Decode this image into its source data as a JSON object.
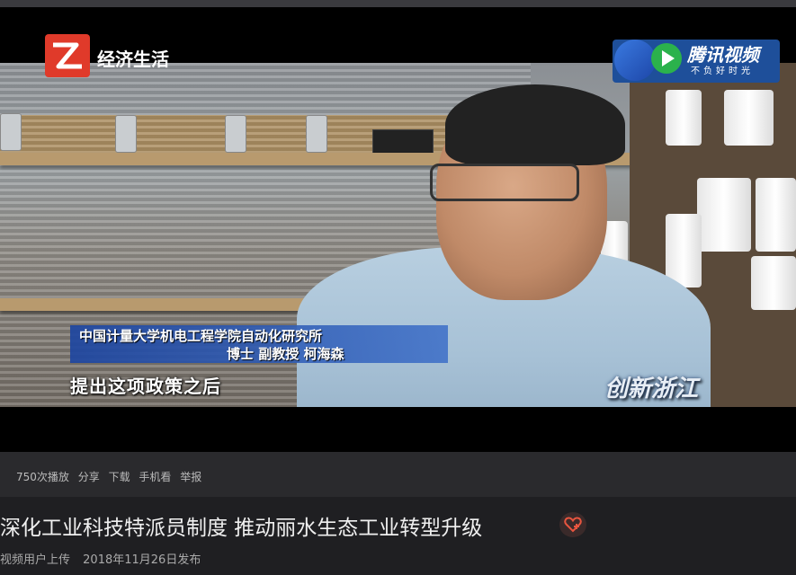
{
  "video": {
    "channel_name": "经济生活",
    "brand_name": "腾讯视频",
    "brand_slogan": "不负好时光",
    "caption_line1": "中国计量大学机电工程学院自动化研究所",
    "caption_line2": "博士  副教授  柯海森",
    "subtitle": "提出这项政策之后",
    "show_logo": "创新浙江"
  },
  "stats": {
    "plays": "750次播放",
    "share": "分享",
    "download": "下载",
    "mobile": "手机看",
    "report": "举报"
  },
  "info": {
    "title": "深化工业科技特派员制度 推动丽水生态工业转型升级",
    "uploader": "视频用户上传",
    "published": "2018年11月26日发布"
  },
  "colors": {
    "accent": "#e8553f",
    "page_bg": "#2a2a2d",
    "caption_bg": "#2a5ab0"
  },
  "icons": {
    "favorite": "heart-plus-icon",
    "channel": "zhejiang-tv-logo",
    "brand": "tencent-video-logo"
  }
}
